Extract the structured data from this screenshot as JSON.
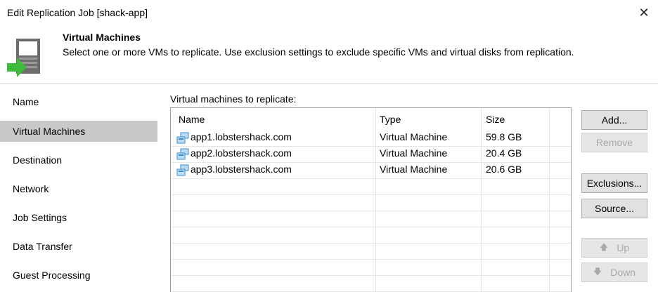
{
  "window": {
    "title": "Edit Replication Job [shack-app]",
    "close_glyph": "✕"
  },
  "header": {
    "title": "Virtual Machines",
    "description": "Select one or more VMs to replicate. Use exclusion settings to exclude specific VMs and virtual disks from replication.",
    "icon": "vm-wizard-icon"
  },
  "sidebar": {
    "items": [
      {
        "label": "Name",
        "active": false
      },
      {
        "label": "Virtual Machines",
        "active": true
      },
      {
        "label": "Destination",
        "active": false
      },
      {
        "label": "Network",
        "active": false
      },
      {
        "label": "Job Settings",
        "active": false
      },
      {
        "label": "Data Transfer",
        "active": false
      },
      {
        "label": "Guest Processing",
        "active": false
      }
    ]
  },
  "main": {
    "list_label": "Virtual machines to replicate:",
    "columns": [
      "Name",
      "Type",
      "Size"
    ],
    "rows": [
      {
        "name": "app1.lobstershack.com",
        "type": "Virtual Machine",
        "size": "59.8 GB"
      },
      {
        "name": "app2.lobstershack.com",
        "type": "Virtual Machine",
        "size": "20.4 GB"
      },
      {
        "name": "app3.lobstershack.com",
        "type": "Virtual Machine",
        "size": "20.6 GB"
      }
    ],
    "buttons": {
      "add": "Add...",
      "remove": "Remove",
      "exclusions": "Exclusions...",
      "source": "Source...",
      "up": "Up",
      "down": "Down",
      "up_arrow": "🡅",
      "down_arrow": "🡇"
    }
  },
  "colors": {
    "selection": "#c9c9c9",
    "accent_green": "#3dbb3d",
    "vm_icon_blue": "#3a8fd6"
  }
}
